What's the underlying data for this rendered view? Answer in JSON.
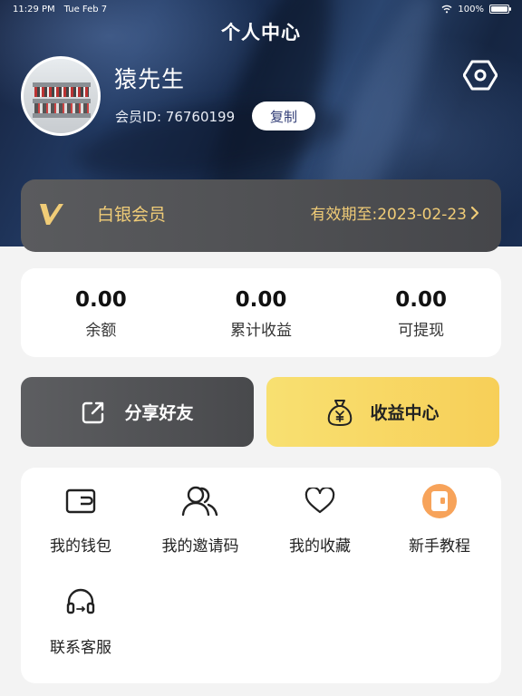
{
  "status_bar": {
    "time": "11:29 PM",
    "date": "Tue Feb 7",
    "battery": "100%"
  },
  "header": {
    "title": "个人中心"
  },
  "profile": {
    "name": "猿先生",
    "member_id": "会员ID: 76760199",
    "copy_label": "复制"
  },
  "membership": {
    "level": "白银会员",
    "expiry": "有效期至:2023-02-23",
    "accent_color": "#f0cc77"
  },
  "stats": [
    {
      "value": "0.00",
      "label": "余额"
    },
    {
      "value": "0.00",
      "label": "累计收益"
    },
    {
      "value": "0.00",
      "label": "可提现"
    }
  ],
  "actions": {
    "share_label": "分享好友",
    "income_label": "收益中心"
  },
  "menu": [
    {
      "label": "我的钱包",
      "icon": "wallet-icon"
    },
    {
      "label": "我的邀请码",
      "icon": "users-icon"
    },
    {
      "label": "我的收藏",
      "icon": "heart-icon"
    },
    {
      "label": "新手教程",
      "icon": "tutorial-icon"
    },
    {
      "label": "联系客服",
      "icon": "headset-icon"
    }
  ]
}
